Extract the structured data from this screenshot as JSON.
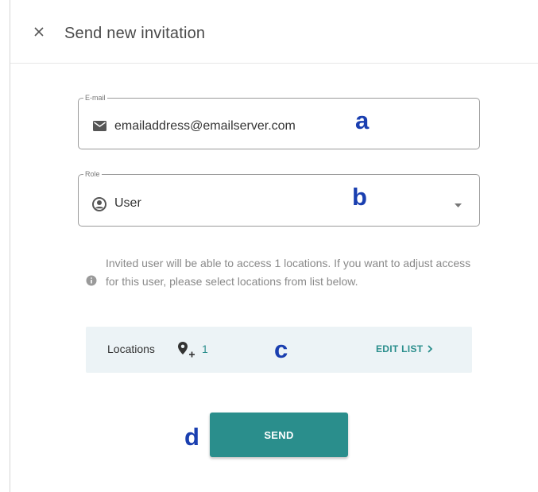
{
  "header": {
    "title": "Send new invitation",
    "close_icon": "close-icon"
  },
  "email_field": {
    "legend": "E-mail",
    "icon": "email-icon",
    "value": "emailaddress@emailserver.com"
  },
  "role_field": {
    "legend": "Role",
    "icon": "person-icon",
    "value": "User",
    "dropdown_icon": "dropdown-arrow-icon"
  },
  "info": {
    "icon": "info-icon",
    "text": "Invited user will be able to access 1 locations. If you want to adjust access for this user, please select locations from list below."
  },
  "locations": {
    "label": "Locations",
    "icon": "location-add-icon",
    "count": "1",
    "edit_label": "EDIT LIST"
  },
  "send_button": {
    "label": "SEND"
  },
  "annotations": {
    "a": "a",
    "b": "b",
    "c": "c",
    "d": "d"
  },
  "colors": {
    "accent": "#2a8e8c",
    "annotation": "#1a3fb0",
    "locations_bg": "#ecf3f6",
    "info_text": "#8a8a8a"
  }
}
